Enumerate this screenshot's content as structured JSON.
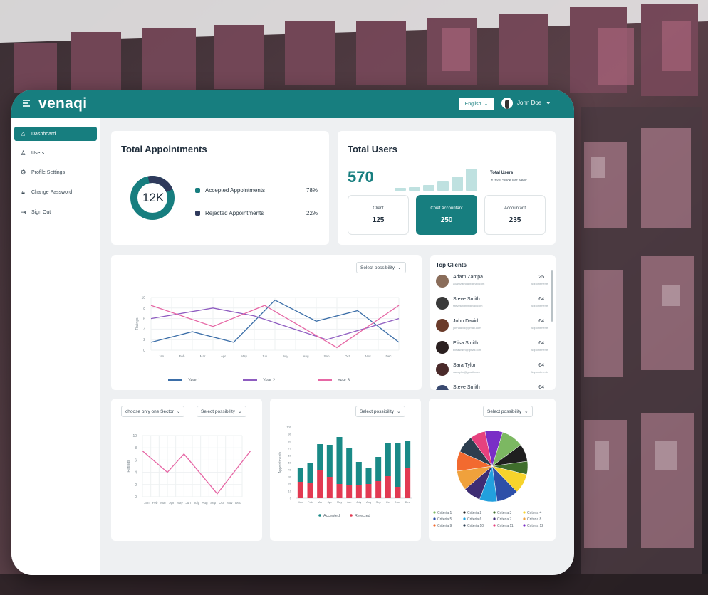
{
  "app": {
    "logo": "venaqi",
    "language": "English",
    "user_name": "John Doe"
  },
  "sidebar": {
    "items": [
      {
        "label": "Dashboard",
        "icon": "home-icon",
        "active": true
      },
      {
        "label": "Users",
        "icon": "user-icon",
        "active": false
      },
      {
        "label": "Profile Settings",
        "icon": "gear-icon",
        "active": false
      },
      {
        "label": "Change Password",
        "icon": "lock-icon",
        "active": false
      },
      {
        "label": "Sign Out",
        "icon": "sign-out-icon",
        "active": false
      }
    ]
  },
  "appointments": {
    "title": "Total Appointments",
    "total": "12K",
    "accepted_label": "Accepted Appointments",
    "accepted_pct": "78%",
    "accepted_value": 78,
    "rejected_label": "Rejected Appointments",
    "rejected_pct": "22%",
    "rejected_value": 22
  },
  "users": {
    "title": "Total Users",
    "total": "570",
    "trend_label": "Total Users",
    "trend_sub": "↗ 36%  Since last week",
    "bar_levels": [
      0.1,
      0.15,
      0.22,
      0.35,
      0.55,
      0.85
    ],
    "roles": [
      {
        "name": "Client",
        "value": "125",
        "active": false
      },
      {
        "name": "Chief Accountant",
        "value": "250",
        "active": true
      },
      {
        "name": "Accountant",
        "value": "235",
        "active": false
      }
    ]
  },
  "line_card": {
    "select": "Select possibility",
    "legend": [
      "Year 1",
      "Year 2",
      "Year 3"
    ]
  },
  "top_clients": {
    "title": "Top Clients",
    "rows": [
      {
        "name": "Adam Zampa",
        "email": "adamzampa@gmail.com",
        "count": "25",
        "sub": "Appointments"
      },
      {
        "name": "Steve Smith",
        "email": "stevesmith@gmail.com",
        "count": "64",
        "sub": "Appointments"
      },
      {
        "name": "John David",
        "email": "johndavid@gmail.com",
        "count": "64",
        "sub": "Appointments"
      },
      {
        "name": "Elisa Smith",
        "email": "elisasmith@gmail.com",
        "count": "64",
        "sub": "Appointments"
      },
      {
        "name": "Sara Tylor",
        "email": "saratylor@gmail.com",
        "count": "64",
        "sub": "Appointments"
      },
      {
        "name": "Steve Smith",
        "email": "",
        "count": "64",
        "sub": ""
      }
    ]
  },
  "sector_card": {
    "select_sector": "choose only one Sector",
    "select_possibility": "Select possibility"
  },
  "bar_card": {
    "select": "Select possibility",
    "legend_accepted": "Accepted",
    "legend_rejected": "Rejected"
  },
  "pie_card": {
    "select": "Select possibility",
    "legend": [
      "Criteria 1",
      "Criteria 2",
      "Criteria 3",
      "Criteria 4",
      "Criteria 5",
      "Criteria 6",
      "Criteria 7",
      "Criteria 8",
      "Criteria 9",
      "Criteria 10",
      "Criteria 11",
      "Criteria 12"
    ]
  },
  "colors": {
    "teal": "#177e7f",
    "navy": "#2f3a5c",
    "year1": "#3b6ea8",
    "year2": "#8e5cc0",
    "year3": "#e667a5",
    "accepted": "#1a8a87",
    "rejected": "#e23a52"
  },
  "chart_data": [
    {
      "type": "line",
      "ylabel": "Ratings",
      "x": [
        "Jan",
        "Feb",
        "Mar",
        "Apr",
        "May",
        "Jun",
        "July",
        "Aug",
        "Sep",
        "Oct",
        "Nov",
        "Dec"
      ],
      "yticks": [
        0,
        2,
        4,
        6,
        8,
        10
      ],
      "ylim": [
        0,
        10
      ],
      "series": [
        {
          "name": "Year 1",
          "values": [
            1.5,
            null,
            3.5,
            null,
            1.5,
            null,
            9.5,
            null,
            5.5,
            null,
            7.5,
            null,
            1.5
          ],
          "points": [
            [
              0,
              1.5
            ],
            [
              2,
              3.5
            ],
            [
              4,
              1.5
            ],
            [
              6,
              9.5
            ],
            [
              8,
              5.5
            ],
            [
              10,
              7.5
            ],
            [
              12,
              1.5
            ]
          ]
        },
        {
          "name": "Year 2",
          "points": [
            [
              0,
              6
            ],
            [
              3,
              8
            ],
            [
              5,
              6.5
            ],
            [
              8.5,
              2
            ],
            [
              12,
              6
            ]
          ]
        },
        {
          "name": "Year 3",
          "points": [
            [
              0,
              8.5
            ],
            [
              3,
              4.5
            ],
            [
              5.5,
              8.5
            ],
            [
              9,
              0.5
            ],
            [
              12,
              8.5
            ]
          ]
        }
      ]
    },
    {
      "type": "line",
      "ylabel": "Ratings",
      "x": [
        "Jan",
        "Feb",
        "Mar",
        "Apr",
        "May",
        "Jun",
        "July",
        "Aug",
        "Sep",
        "Oct",
        "Nov",
        "Dec"
      ],
      "yticks": [
        0,
        2,
        4,
        6,
        8,
        10
      ],
      "ylim": [
        0,
        10
      ],
      "series": [
        {
          "name": "",
          "points": [
            [
              0,
              7.5
            ],
            [
              3,
              4
            ],
            [
              5,
              7
            ],
            [
              9,
              0.5
            ],
            [
              13,
              7.5
            ]
          ]
        }
      ]
    },
    {
      "type": "bar",
      "ylabel": "Appointments",
      "categories": [
        "Jan",
        "Feb",
        "Mar",
        "Apr",
        "May",
        "Jun",
        "July",
        "Aug",
        "Sep",
        "Oct",
        "Nov",
        "Dec"
      ],
      "yticks": [
        0,
        10,
        20,
        30,
        40,
        50,
        60,
        70,
        80,
        90,
        100
      ],
      "ylim": [
        0,
        100
      ],
      "series": [
        {
          "name": "Accepted",
          "values": [
            20,
            28,
            36,
            45,
            66,
            53,
            32,
            22,
            34,
            46,
            61,
            38
          ]
        },
        {
          "name": "Rejected",
          "values": [
            23,
            22,
            40,
            30,
            20,
            18,
            19,
            20,
            24,
            31,
            16,
            42
          ]
        }
      ]
    },
    {
      "type": "pie",
      "categories": [
        "Criteria 1",
        "Criteria 2",
        "Criteria 3",
        "Criteria 4",
        "Criteria 5",
        "Criteria 6",
        "Criteria 7",
        "Criteria 8",
        "Criteria 9",
        "Criteria 10",
        "Criteria 11",
        "Criteria 12"
      ],
      "values": [
        10,
        8,
        6,
        9,
        10,
        8,
        8,
        9,
        9,
        8,
        7,
        8
      ],
      "colors": [
        "#7cb862",
        "#1f1f1f",
        "#3f6e2c",
        "#f7d32b",
        "#2e4fa8",
        "#22a0de",
        "#3e2d74",
        "#f0a13c",
        "#f26a2f",
        "#2c3e4f",
        "#e6417e",
        "#7a2ec6"
      ]
    }
  ]
}
